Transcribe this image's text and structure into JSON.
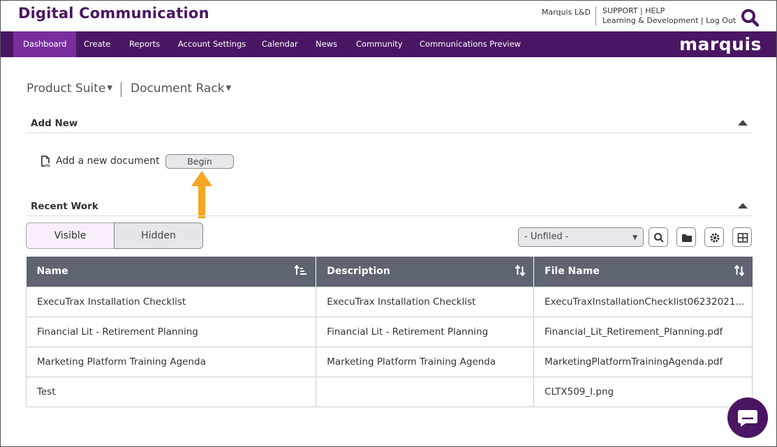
{
  "header": {
    "app_title": "Digital Communication",
    "user_org": "Marquis L&D",
    "support": "SUPPORT",
    "help": "HELP",
    "org_name": "Learning & Development",
    "logout": "Log Out",
    "brand": "marquis"
  },
  "nav": {
    "items": [
      {
        "label": "Dashboard",
        "active": true
      },
      {
        "label": "Create"
      },
      {
        "label": "Reports"
      },
      {
        "label": "Account Settings"
      },
      {
        "label": "Calendar"
      },
      {
        "label": "News"
      },
      {
        "label": "Community"
      },
      {
        "label": "Communications Preview"
      }
    ]
  },
  "breadcrumb": {
    "product_suite": "Product Suite",
    "document_rack": "Document Rack"
  },
  "add_new": {
    "title": "Add New",
    "label": "Add a new document",
    "button": "Begin"
  },
  "recent_work": {
    "title": "Recent Work",
    "tab_visible": "Visible",
    "tab_hidden": "Hidden",
    "filter_value": "- Unfiled -",
    "columns": [
      "Name",
      "Description",
      "File Name"
    ],
    "rows": [
      [
        "ExecuTrax Installation Checklist",
        "ExecuTrax Installation Checklist",
        "ExecuTraxInstallationChecklist06232021..."
      ],
      [
        "Financial Lit - Retirement Planning",
        "Financial Lit - Retirement Planning",
        "Financial_Lit_Retirement_Planning.pdf"
      ],
      [
        "Marketing Platform Training Agenda",
        "Marketing Platform Training Agenda",
        "MarketingPlatformTrainingAgenda.pdf"
      ],
      [
        "Test",
        "",
        "CLTX509_I.png"
      ]
    ]
  },
  "colors": {
    "brand_purple": "#4a1563",
    "nav_active": "#7a2e9e",
    "table_header": "#5e6470",
    "arrow": "#f5a623"
  }
}
